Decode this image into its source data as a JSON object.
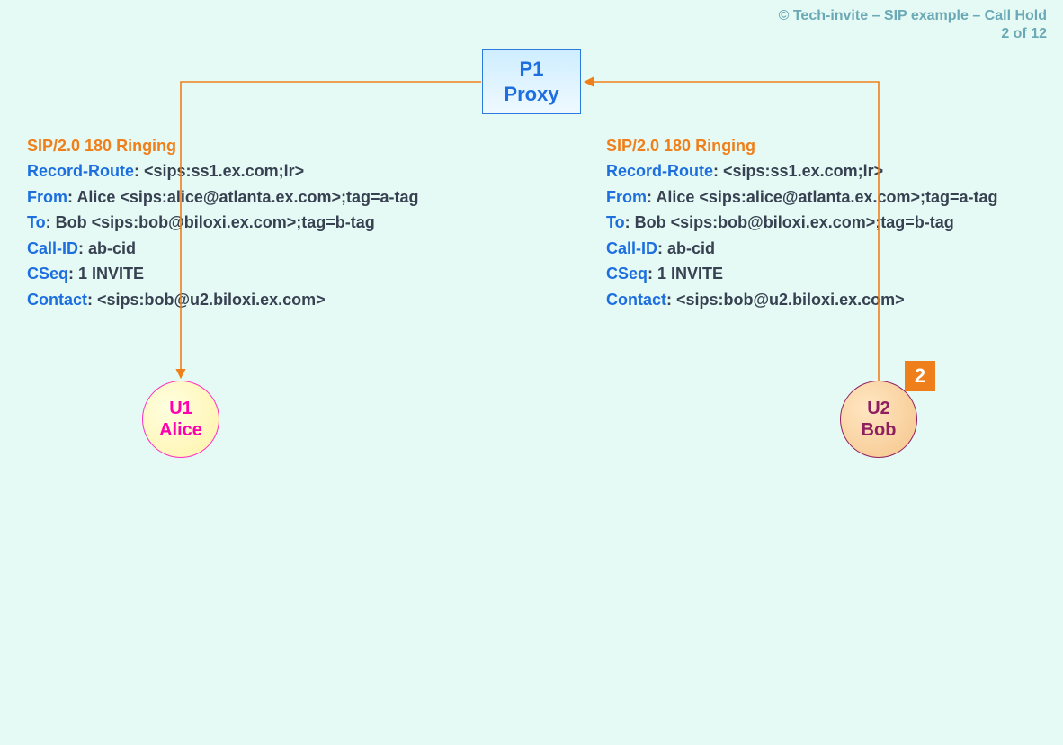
{
  "copyright": {
    "line1": "© Tech-invite – SIP example – Call Hold",
    "line2": "2 of 12"
  },
  "proxy": {
    "line1": "P1",
    "line2": "Proxy"
  },
  "u1": {
    "line1": "U1",
    "line2": "Alice"
  },
  "u2": {
    "line1": "U2",
    "line2": "Bob"
  },
  "step_badge": "2",
  "sip_left": {
    "status": "SIP/2.0 180 Ringing",
    "record_route": {
      "name": "Record-Route",
      "value": ": <sips:ss1.ex.com;lr>"
    },
    "from": {
      "name": "From",
      "value": ": Alice <sips:alice@atlanta.ex.com>;tag=a-tag"
    },
    "to": {
      "name": "To",
      "value": ": Bob <sips:bob@biloxi.ex.com>;tag=b-tag"
    },
    "call_id": {
      "name": "Call-ID",
      "value": ": ab-cid"
    },
    "cseq": {
      "name": "CSeq",
      "value": ": 1 INVITE"
    },
    "contact": {
      "name": "Contact",
      "value": ": <sips:bob@u2.biloxi.ex.com>"
    }
  },
  "sip_right": {
    "status": "SIP/2.0 180 Ringing",
    "record_route": {
      "name": "Record-Route",
      "value": ": <sips:ss1.ex.com;lr>"
    },
    "from": {
      "name": "From",
      "value": ": Alice <sips:alice@atlanta.ex.com>;tag=a-tag"
    },
    "to": {
      "name": "To",
      "value": ": Bob <sips:bob@biloxi.ex.com>;tag=b-tag"
    },
    "call_id": {
      "name": "Call-ID",
      "value": ": ab-cid"
    },
    "cseq": {
      "name": "CSeq",
      "value": ": 1 INVITE"
    },
    "contact": {
      "name": "Contact",
      "value": ": <sips:bob@u2.biloxi.ex.com>"
    }
  }
}
